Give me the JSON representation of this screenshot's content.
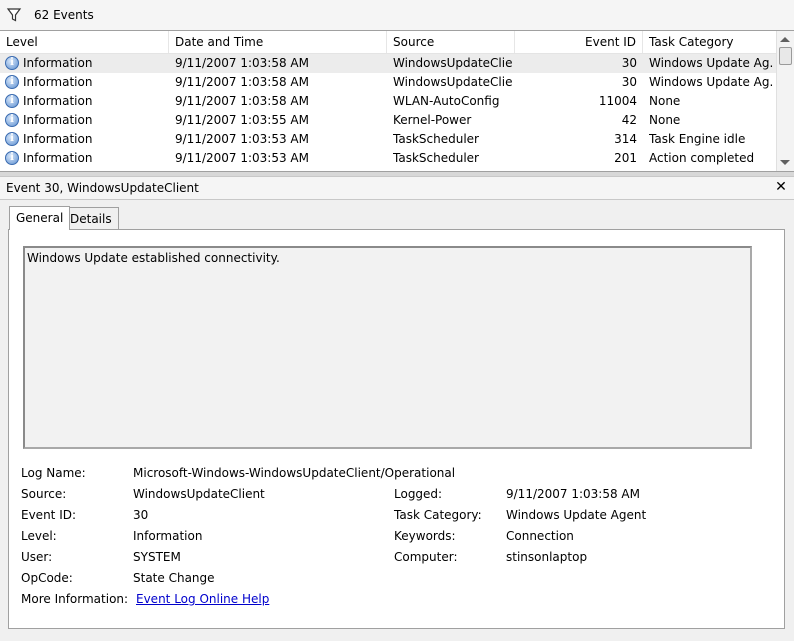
{
  "toolbar": {
    "filter_icon": "filter-funnel-icon",
    "count_label": "62 Events"
  },
  "columns": [
    "Level",
    "Date and Time",
    "Source",
    "Event ID",
    "Task Category"
  ],
  "rows": [
    {
      "level": "Information",
      "datetime": "9/11/2007 1:03:58 AM",
      "source": "WindowsUpdateClie...",
      "event_id": "30",
      "category": "Windows Update Ag..."
    },
    {
      "level": "Information",
      "datetime": "9/11/2007 1:03:58 AM",
      "source": "WindowsUpdateClie...",
      "event_id": "30",
      "category": "Windows Update Ag..."
    },
    {
      "level": "Information",
      "datetime": "9/11/2007 1:03:58 AM",
      "source": "WLAN-AutoConfig",
      "event_id": "11004",
      "category": "None"
    },
    {
      "level": "Information",
      "datetime": "9/11/2007 1:03:55 AM",
      "source": "Kernel-Power",
      "event_id": "42",
      "category": "None"
    },
    {
      "level": "Information",
      "datetime": "9/11/2007 1:03:53 AM",
      "source": "TaskScheduler",
      "event_id": "314",
      "category": "Task Engine idle"
    },
    {
      "level": "Information",
      "datetime": "9/11/2007 1:03:53 AM",
      "source": "TaskScheduler",
      "event_id": "201",
      "category": "Action completed"
    }
  ],
  "detail": {
    "title": "Event 30, WindowsUpdateClient",
    "close_label": "✕",
    "tabs": [
      "General",
      "Details"
    ],
    "message": "Windows Update established connectivity.",
    "fields": {
      "log_name_label": "Log Name:",
      "log_name": "Microsoft-Windows-WindowsUpdateClient/Operational",
      "source_label": "Source:",
      "source": "WindowsUpdateClient",
      "logged_label": "Logged:",
      "logged": "9/11/2007 1:03:58 AM",
      "event_id_label": "Event ID:",
      "event_id": "30",
      "task_category_label": "Task Category:",
      "task_category": "Windows Update Agent",
      "level_label": "Level:",
      "level": "Information",
      "keywords_label": "Keywords:",
      "keywords": "Connection",
      "user_label": "User:",
      "user": "SYSTEM",
      "computer_label": "Computer:",
      "computer": "stinsonlaptop",
      "opcode_label": "OpCode:",
      "opcode": "State Change",
      "more_info_label": "More Information:",
      "more_info_link": "Event Log Online Help"
    }
  }
}
